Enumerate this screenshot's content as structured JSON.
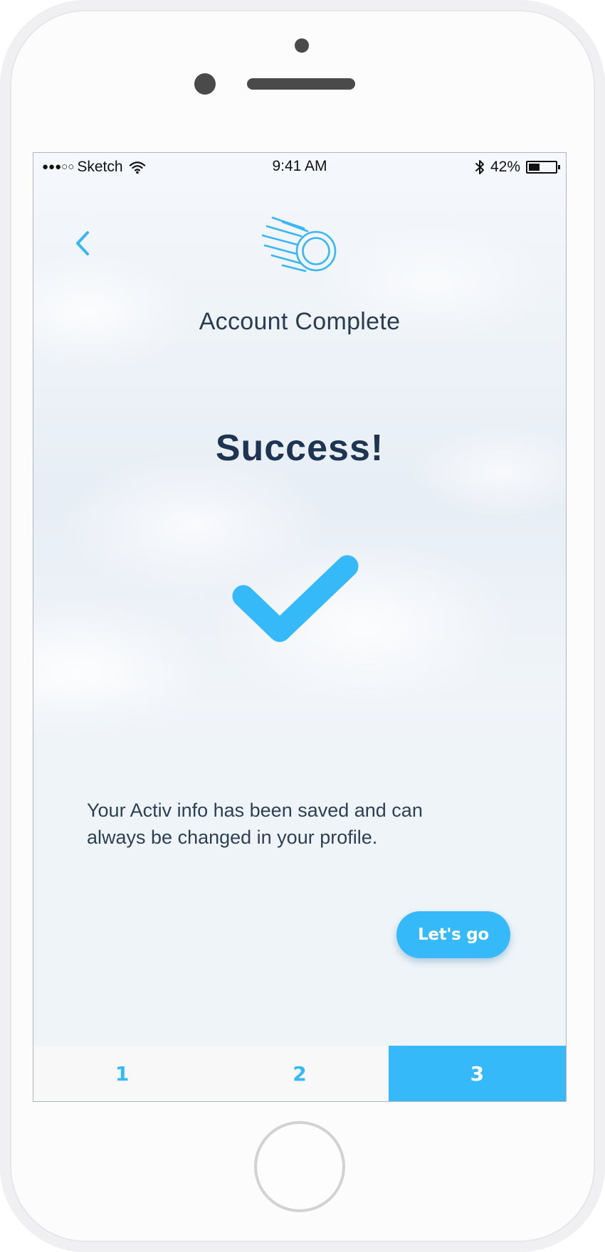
{
  "device": {
    "front_camera_icon": "front-camera",
    "speaker_icon": "speaker-grille",
    "home_button_icon": "home-button"
  },
  "status_bar": {
    "signal_indicator": "●●●○○",
    "carrier": "Sketch",
    "wifi_icon": "wifi-icon",
    "time": "9:41 AM",
    "bluetooth_icon": "bluetooth-icon",
    "battery_percent_text": "42%",
    "battery_level": 0.42
  },
  "header": {
    "back_icon": "chevron-left-icon",
    "logo_icon": "speed-ball-icon",
    "title": "Account Complete"
  },
  "content": {
    "success_title": "Success!",
    "success_icon": "checkmark-icon",
    "message": "Your Activ info has been saved and can always be changed in your profile.",
    "button_label": "Let's go"
  },
  "steps": {
    "items": [
      {
        "label": "1",
        "active": false
      },
      {
        "label": "2",
        "active": false
      },
      {
        "label": "3",
        "active": true
      }
    ]
  },
  "colors": {
    "accent": "#36b9f9",
    "heading": "#1d3550",
    "body_text": "#2d3f54",
    "screen_background": "#eff4f9"
  }
}
